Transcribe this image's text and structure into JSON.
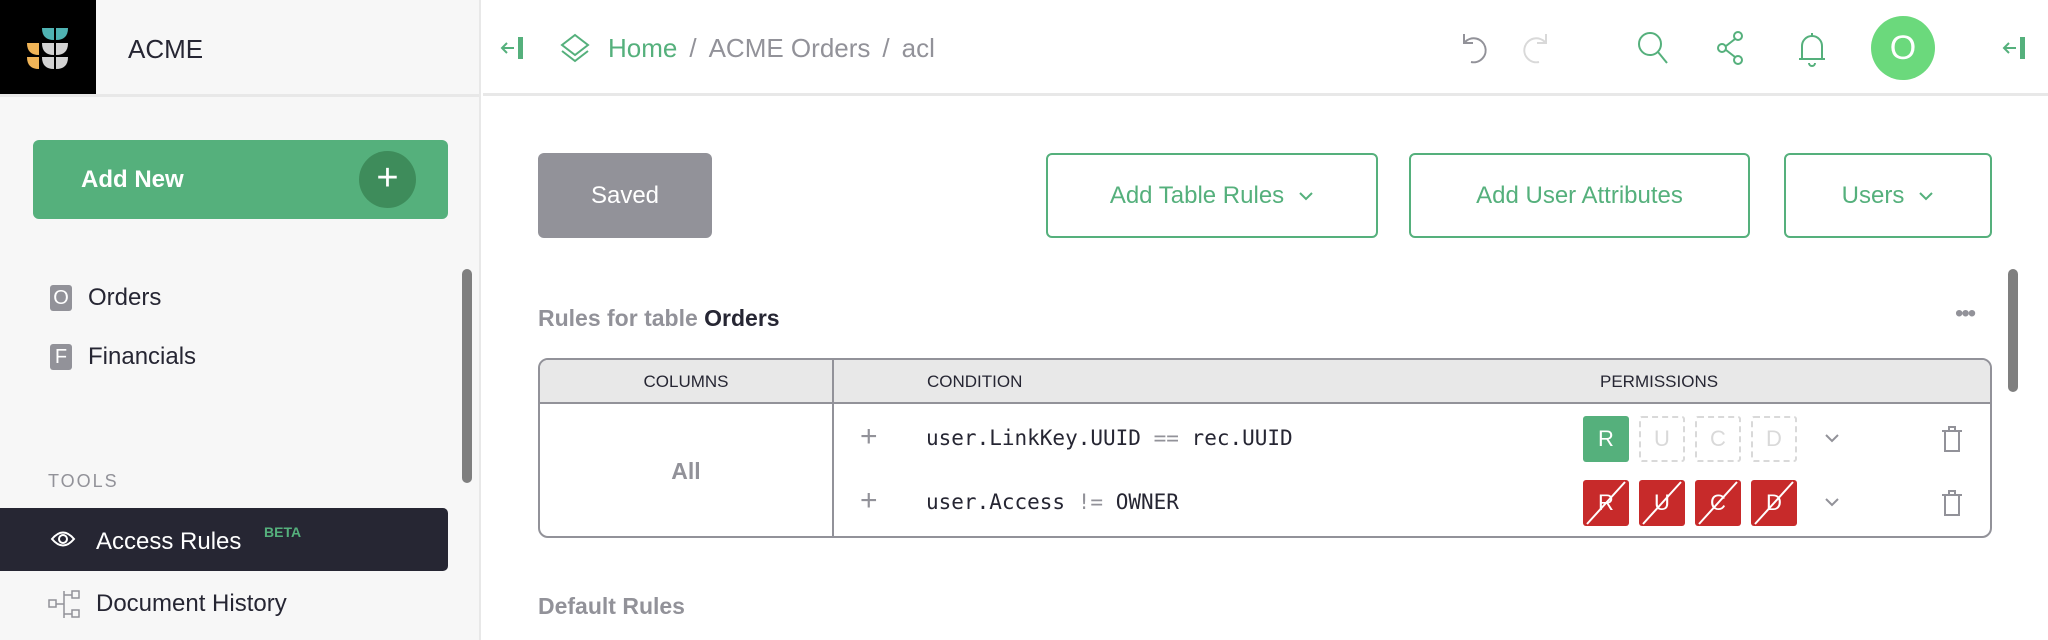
{
  "app": {
    "brand": "ACME"
  },
  "breadcrumb": {
    "home": "Home",
    "doc": "ACME Orders",
    "page": "acl",
    "sep": "/"
  },
  "avatar": {
    "initial": "O"
  },
  "sidebar": {
    "add_new": "Add New",
    "documents": [
      {
        "badge": "O",
        "label": "Orders"
      },
      {
        "badge": "F",
        "label": "Financials"
      }
    ],
    "tools_heading": "TOOLS",
    "tools": [
      {
        "label": "Access Rules",
        "badge": "BETA",
        "active": true
      },
      {
        "label": "Document History"
      }
    ]
  },
  "toolbar": {
    "saved": "Saved",
    "add_table_rules": "Add Table Rules",
    "add_user_attributes": "Add User Attributes",
    "users": "Users"
  },
  "rules": {
    "title_prefix": "Rules for table",
    "table_name": "Orders",
    "headers": {
      "columns": "COLUMNS",
      "condition": "CONDITION",
      "permissions": "PERMISSIONS"
    },
    "columns_value": "All",
    "rows": [
      {
        "cond_left": "user.LinkKey.UUID",
        "op": "==",
        "cond_right": "rec.UUID",
        "perms": {
          "R": "allow",
          "U": "unset",
          "C": "unset",
          "D": "unset"
        }
      },
      {
        "cond_left": "user.Access",
        "op": "!=",
        "cond_right": "OWNER",
        "perms": {
          "R": "deny",
          "U": "deny",
          "C": "deny",
          "D": "deny"
        }
      }
    ]
  },
  "default_rules": "Default Rules",
  "colors": {
    "accent": "#55b07c",
    "dark": "#262633",
    "deny": "#c72a2a",
    "muted": "#929299"
  }
}
